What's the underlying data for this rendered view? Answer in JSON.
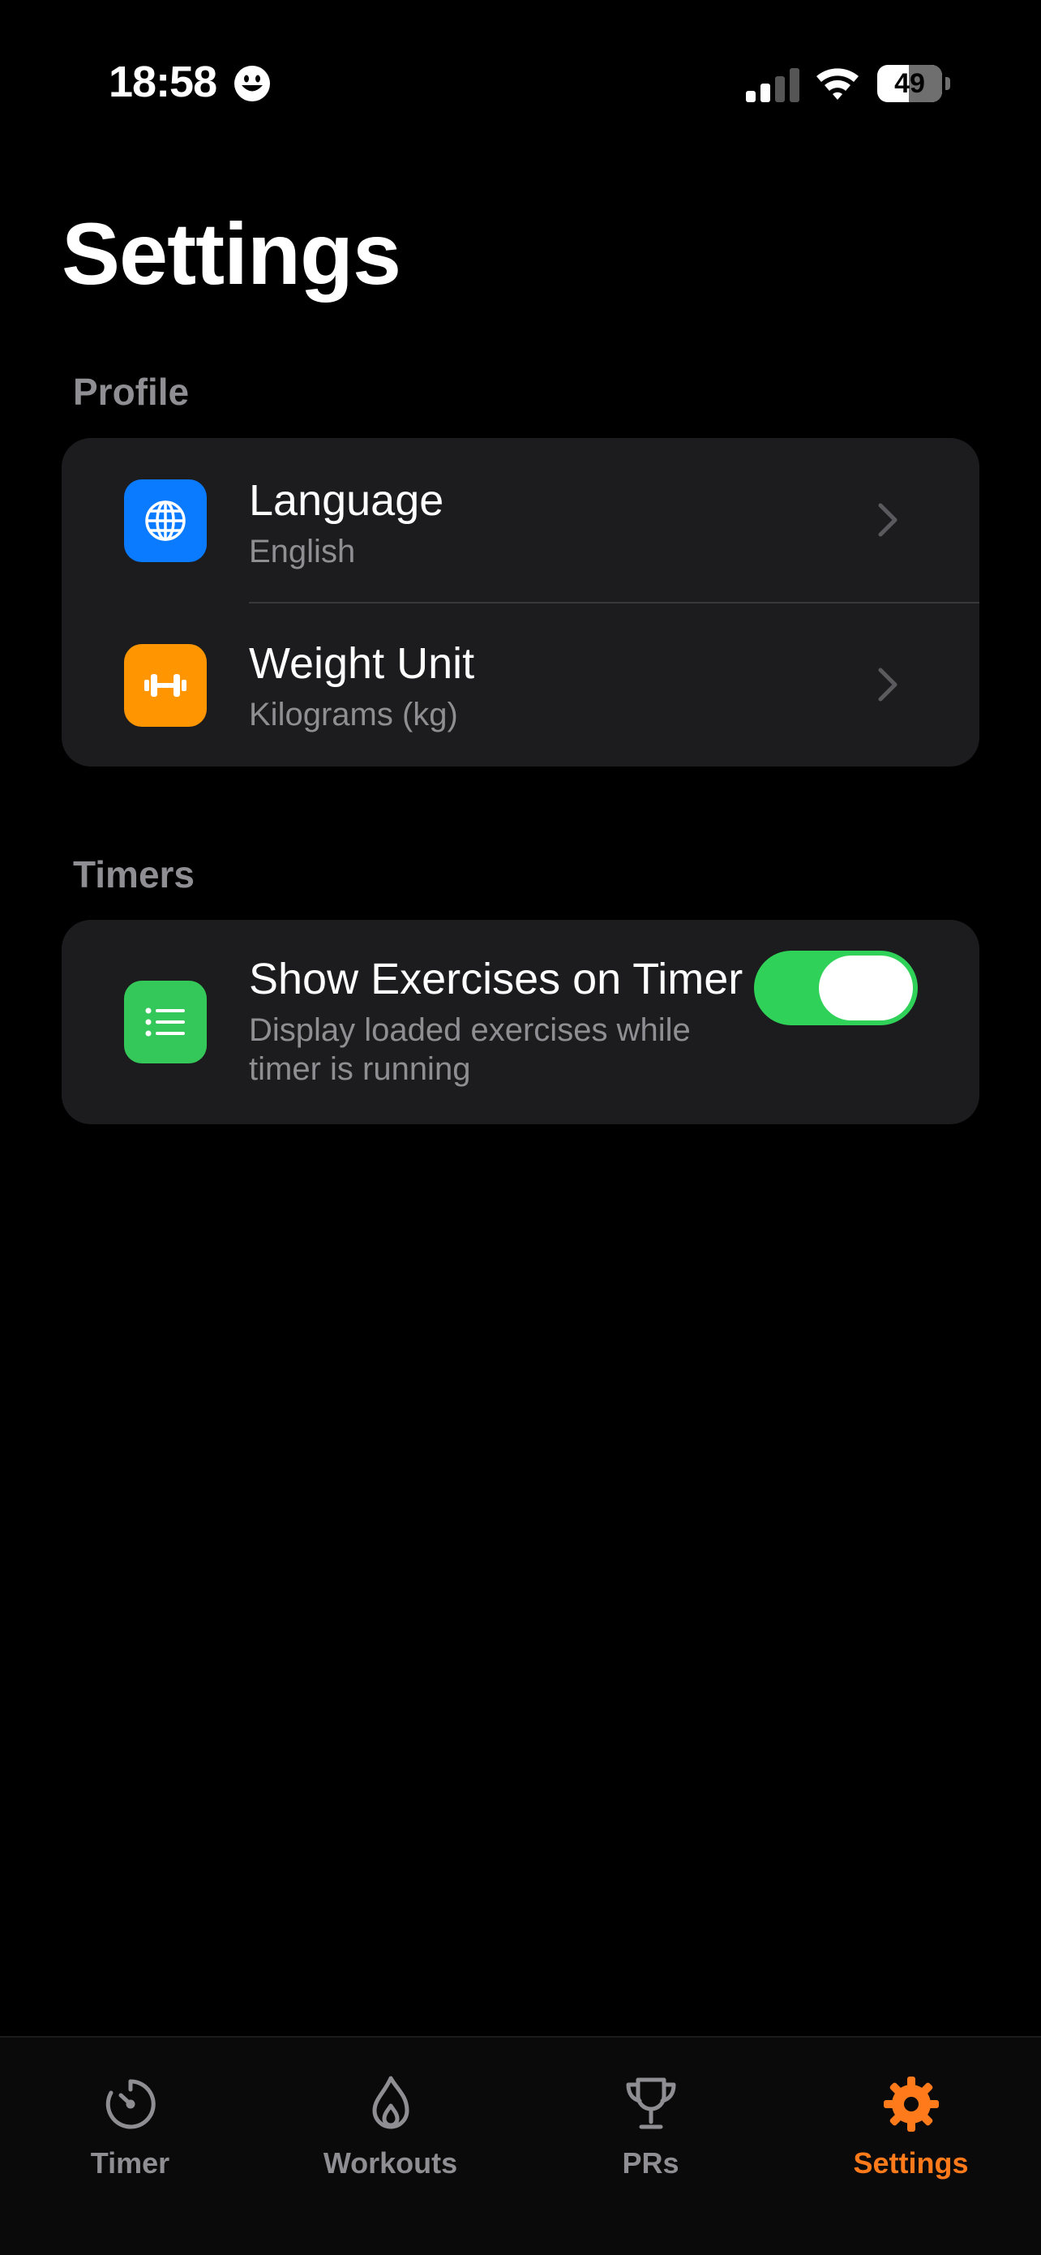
{
  "status_bar": {
    "time": "18:58",
    "battery_level": "49",
    "battery_fraction": 0.49
  },
  "page": {
    "title": "Settings"
  },
  "sections": {
    "profile": {
      "header": "Profile",
      "rows": [
        {
          "title": "Language",
          "value": "English",
          "icon": "globe-icon",
          "icon_color": "#0a7aff"
        },
        {
          "title": "Weight Unit",
          "value": "Kilograms (kg)",
          "icon": "dumbbell-icon",
          "icon_color": "#ff9500"
        }
      ]
    },
    "timers": {
      "header": "Timers",
      "rows": [
        {
          "title": "Show Exercises on Timer",
          "subtitle_line1": "Display loaded exercises while",
          "subtitle_line2": "timer is running",
          "icon": "list-icon",
          "icon_color": "#34c759",
          "toggle_on": true
        }
      ]
    }
  },
  "tabbar": {
    "tabs": [
      {
        "label": "Timer",
        "icon": "stopwatch-icon",
        "active": false
      },
      {
        "label": "Workouts",
        "icon": "flame-icon",
        "active": false
      },
      {
        "label": "PRs",
        "icon": "trophy-icon",
        "active": false
      },
      {
        "label": "Settings",
        "icon": "gear-icon",
        "active": true
      }
    ],
    "active_color": "#ff7a1a",
    "inactive_color": "#8e8e93"
  },
  "colors": {
    "background": "#000000",
    "card": "#1c1c1e",
    "toggle_on": "#30d158"
  }
}
